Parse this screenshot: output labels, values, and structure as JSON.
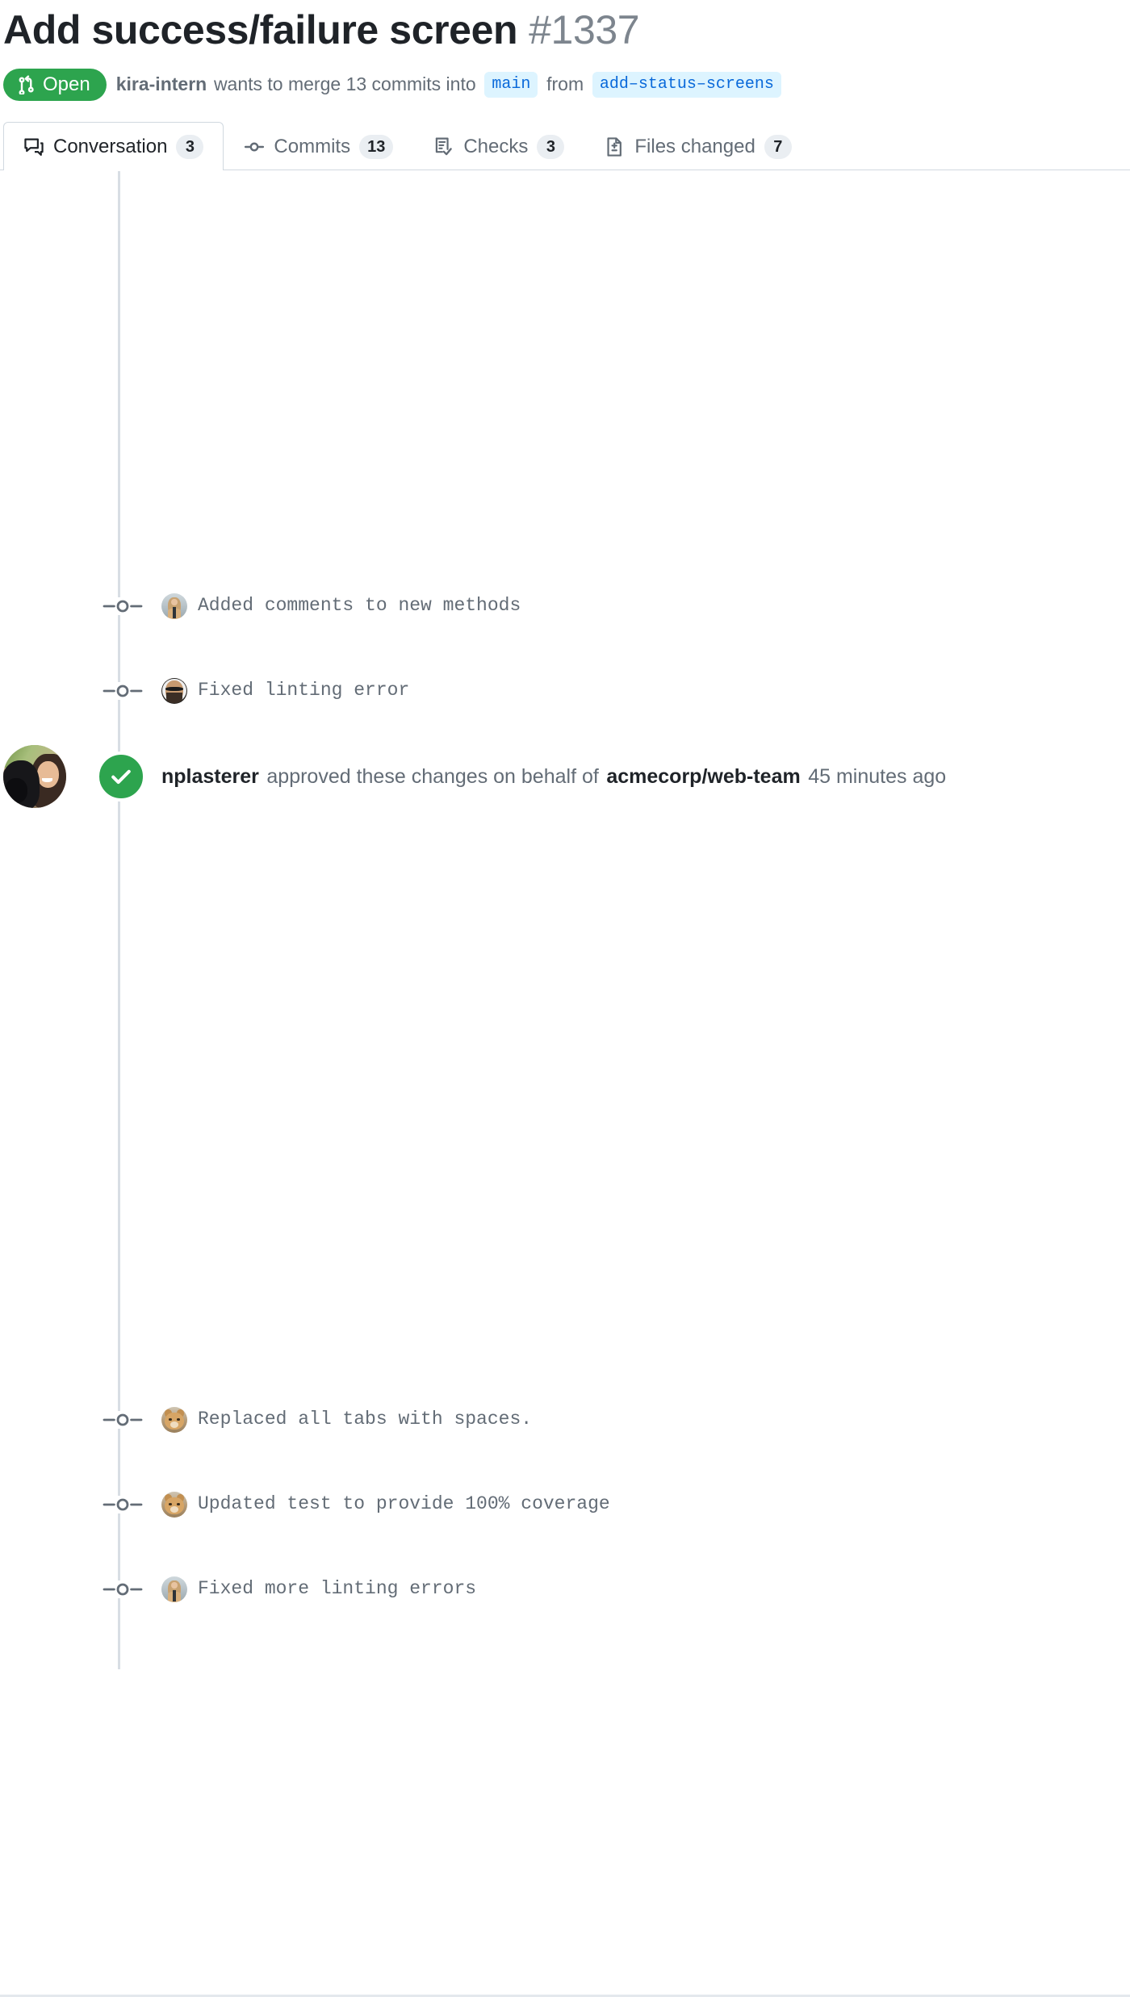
{
  "header": {
    "title": "Add success/failure screen",
    "number": "#1337",
    "state_badge": {
      "label": "Open",
      "icon": "git-pull-request-icon",
      "color": "#2da44e"
    },
    "merge_line": {
      "author": "kira-intern",
      "text_before_base": "wants to merge 13 commits into",
      "base_branch": "main",
      "text_between": "from",
      "head_branch": "add–status–screens"
    }
  },
  "tabs": [
    {
      "id": "conversation",
      "label": "Conversation",
      "count": "3",
      "icon": "comment-discussion-icon",
      "selected": true
    },
    {
      "id": "commits",
      "label": "Commits",
      "count": "13",
      "icon": "git-commit-icon",
      "selected": false
    },
    {
      "id": "checks",
      "label": "Checks",
      "count": "3",
      "icon": "checklist-icon",
      "selected": false
    },
    {
      "id": "files",
      "label": "Files changed",
      "count": "7",
      "icon": "file-diff-icon",
      "selected": false
    }
  ],
  "timeline": {
    "top_commits": [
      {
        "message": "Added comments to new methods",
        "avatar": "av-blonde"
      },
      {
        "message": "Fixed linting error",
        "avatar": "av-shades"
      }
    ],
    "approval": {
      "actor": "nplasterer",
      "action": "approved these changes on behalf of",
      "team": "acmecorp/web-team",
      "timestamp": "45 minutes ago",
      "icon": "check-circle-icon",
      "color": "#2da44e",
      "avatar": "av-dogwoman"
    },
    "bottom_commits": [
      {
        "message": "Replaced all tabs with spaces.",
        "avatar": "av-cat"
      },
      {
        "message": "Updated test to provide 100% coverage",
        "avatar": "av-cat"
      },
      {
        "message": "Fixed more linting errors",
        "avatar": "av-blonde"
      }
    ]
  }
}
